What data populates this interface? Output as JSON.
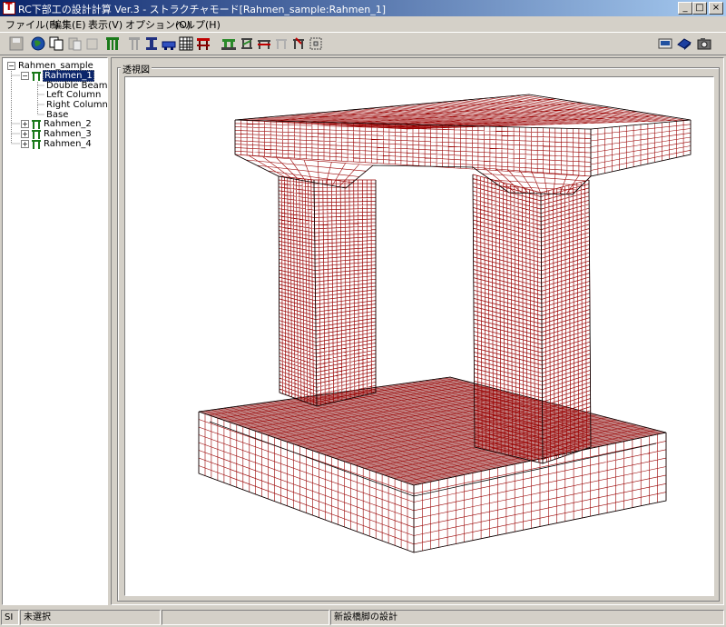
{
  "window": {
    "title": "RC下部工の設計計算 Ver.3 - ストラクチャモード[Rahmen_sample:Rahmen_1]",
    "minimize": "_",
    "maximize": "□",
    "close": "×"
  },
  "menu": {
    "file": "ファイル(F)",
    "edit": "編集(E)",
    "view": "表示(V)",
    "options": "オプション(O)",
    "help": "ヘルプ(H)"
  },
  "tree": {
    "root": "Rahmen_sample",
    "selected": "Rahmen_1",
    "children_of_selected": [
      "Double Beam",
      "Left Column",
      "Right Column",
      "Base"
    ],
    "others": [
      "Rahmen_2",
      "Rahmen_3",
      "Rahmen_4"
    ],
    "expand_minus": "−",
    "expand_plus": "+"
  },
  "viewport": {
    "label": "透視図",
    "mesh_color": "#990000"
  },
  "status": {
    "units": "SI",
    "selection": "未選択",
    "mode": "新設橋脚の設計"
  }
}
